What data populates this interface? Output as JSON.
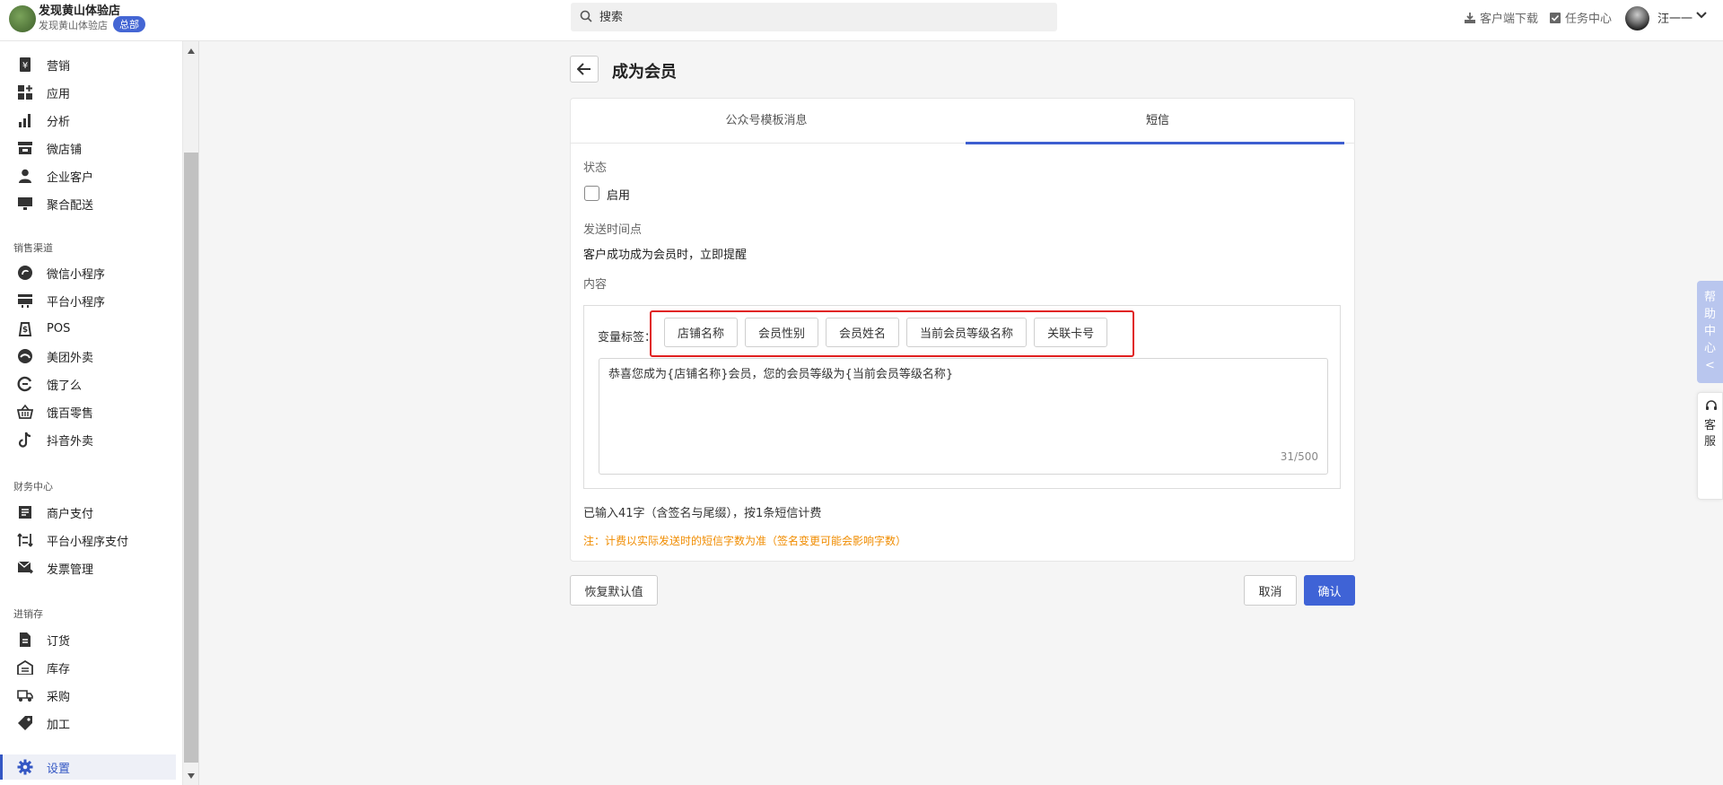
{
  "topbar": {
    "shop_name": "发现黄山体验店",
    "shop_sub": "发现黄山体验店",
    "hq_badge": "总部",
    "search_placeholder": "搜索",
    "links": [
      "客户端下载",
      "任务中心"
    ],
    "user_name": "汪一一"
  },
  "sidebar": {
    "items_top": [
      {
        "label": "营销",
        "icon": "yen-icon"
      },
      {
        "label": "应用",
        "icon": "apps-icon"
      },
      {
        "label": "分析",
        "icon": "bar-chart-icon"
      },
      {
        "label": "微店铺",
        "icon": "store-icon"
      },
      {
        "label": "企业客户",
        "icon": "person-icon"
      },
      {
        "label": "聚合配送",
        "icon": "monitor-icon"
      }
    ],
    "sections": [
      "销售渠道",
      "财务中心",
      "进销存"
    ],
    "items_sales": [
      {
        "label": "微信小程序",
        "icon": "mini-program-icon"
      },
      {
        "label": "平台小程序",
        "icon": "platform-icon"
      },
      {
        "label": "POS",
        "icon": "pos-icon"
      },
      {
        "label": "美团外卖",
        "icon": "meituan-icon"
      },
      {
        "label": "饿了么",
        "icon": "eleme-icon"
      },
      {
        "label": "饿百零售",
        "icon": "basket-icon"
      },
      {
        "label": "抖音外卖",
        "icon": "tiktok-icon"
      }
    ],
    "items_finance": [
      {
        "label": "商户支付",
        "icon": "document-icon"
      },
      {
        "label": "平台小程序支付",
        "icon": "transfer-icon"
      },
      {
        "label": "发票管理",
        "icon": "invoice-icon"
      }
    ],
    "items_inventory": [
      {
        "label": "订货",
        "icon": "file-icon"
      },
      {
        "label": "库存",
        "icon": "warehouse-icon"
      },
      {
        "label": "采购",
        "icon": "truck-icon"
      },
      {
        "label": "加工",
        "icon": "tag-icon"
      }
    ],
    "settings": {
      "label": "设置",
      "icon": "gear-icon"
    }
  },
  "page": {
    "title": "成为会员",
    "tabs": [
      "公众号模板消息",
      "短信"
    ],
    "active_tab": 1,
    "status_label": "状态",
    "enable_label": "启用",
    "enabled": false,
    "send_time_label": "发送时间点",
    "send_time_value": "客户成功成为会员时，立即提醒",
    "content_label": "内容",
    "variable_label": "变量标签：",
    "variables": [
      "店铺名称",
      "会员性别",
      "会员姓名",
      "当前会员等级名称",
      "关联卡号"
    ],
    "message": "恭喜您成为{店铺名称}会员，您的会员等级为{当前会员等级名称}",
    "counter": "31/500",
    "note_count": "已输入41字（含签名与尾缀），按1条短信计费",
    "note_warning": "注：计费以实际发送时的短信字数为准（签名变更可能会影响字数）",
    "restore_button": "恢复默认值",
    "cancel_button": "取消",
    "confirm_button": "确认"
  },
  "widgets": {
    "help": [
      "帮",
      "助",
      "中",
      "心",
      "<"
    ],
    "service": [
      "客",
      "服"
    ]
  },
  "colors": {
    "accent": "#3f63d6",
    "warning": "#f08c00",
    "highlight": "#e02020"
  }
}
